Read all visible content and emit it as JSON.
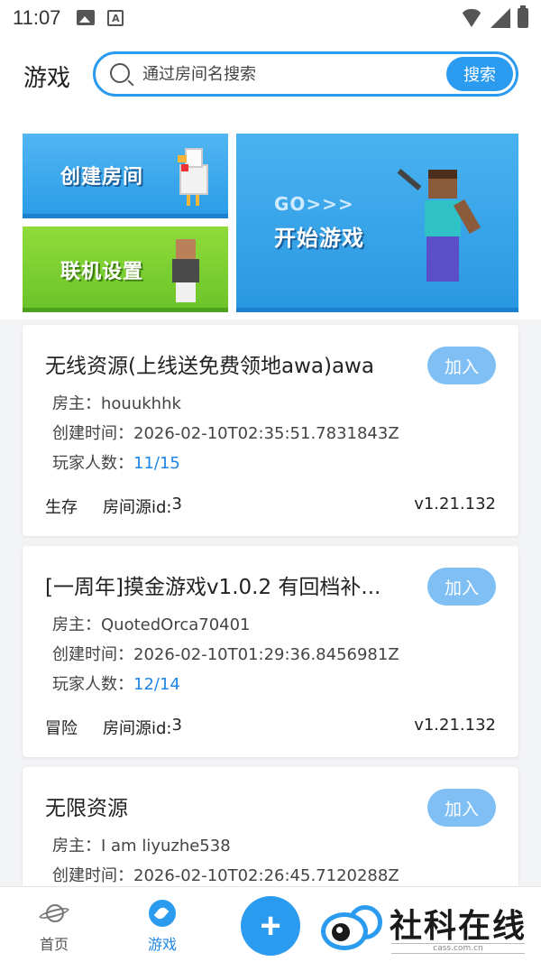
{
  "status_bar": {
    "time": "11:07"
  },
  "header": {
    "title": "游戏",
    "search": {
      "placeholder": "通过房间名搜索",
      "value": "",
      "button_label": "搜索"
    }
  },
  "banners": {
    "create_room": "创建房间",
    "multiplayer_settings": "联机设置",
    "start_game_go": "GO>>>",
    "start_game": "开始游戏"
  },
  "labels": {
    "host": "房主：",
    "created": "创建时间：",
    "players": "玩家人数：",
    "source": "房间源id: ",
    "join": "加入"
  },
  "rooms": [
    {
      "name": "无线资源(上线送免费领地awa)awa",
      "host": "houukhhk",
      "created": "2026-02-10T02:35:51.7831843Z",
      "players": "11/15",
      "mode": "生存",
      "source_id": "3",
      "version": "v1.21.132"
    },
    {
      "name": "[一周年]摸金游戏v1.0.2 有回档补...",
      "host": "QuotedOrca70401",
      "created": "2026-02-10T01:29:36.8456981Z",
      "players": "12/14",
      "mode": "冒险",
      "source_id": "3",
      "version": "v1.21.132"
    },
    {
      "name": "无限资源",
      "host": "I am liyuzhe538",
      "created": "2026-02-10T02:26:45.7120288Z"
    }
  ],
  "bottom_nav": {
    "home": "首页",
    "games": "游戏",
    "fab": "+"
  },
  "watermark": {
    "text": "社科在线",
    "sub": "cass.com.cn"
  },
  "colors": {
    "accent": "#2b9bf0",
    "join_button": "#7fbff4",
    "players_value": "#1e86e6"
  }
}
